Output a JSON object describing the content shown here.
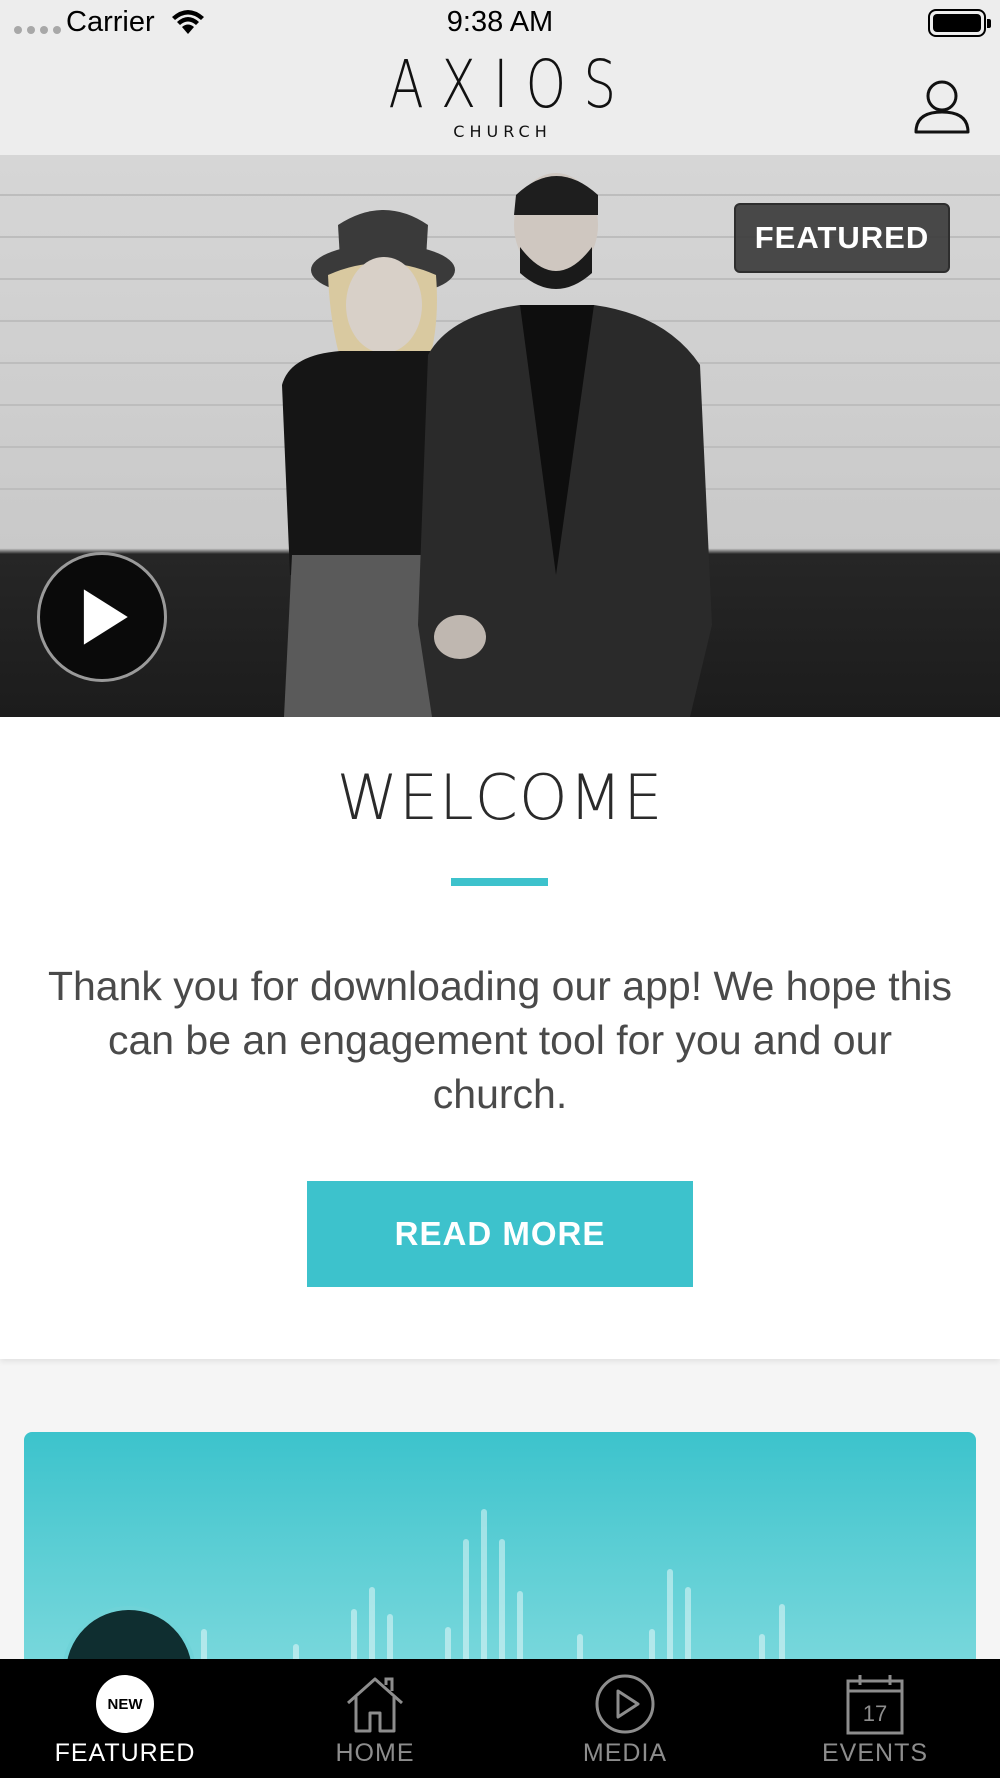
{
  "status_bar": {
    "carrier": "Carrier",
    "time": "9:38 AM"
  },
  "header": {
    "logo_main": "AXIOS",
    "logo_sub": "CHURCH",
    "profile_icon": "person-outline-icon"
  },
  "hero": {
    "badge": "FEATURED",
    "play_icon": "play-icon"
  },
  "welcome_card": {
    "title": "WELCOME",
    "body": "Thank you for downloading our app! We hope this can be an engagement tool for you and our church.",
    "button_label": "READ MORE"
  },
  "colors": {
    "accent": "#3dc2cc",
    "tab_bar_bg": "#000000",
    "tab_inactive": "#8d8d8d"
  },
  "tab_bar": {
    "tabs": [
      {
        "label": "FEATURED",
        "icon": "new-badge-icon",
        "badge": "NEW",
        "active": true
      },
      {
        "label": "HOME",
        "icon": "home-icon",
        "active": false
      },
      {
        "label": "MEDIA",
        "icon": "play-circle-icon",
        "active": false
      },
      {
        "label": "EVENTS",
        "icon": "calendar-icon",
        "calendar_day": "17",
        "active": false
      }
    ]
  }
}
